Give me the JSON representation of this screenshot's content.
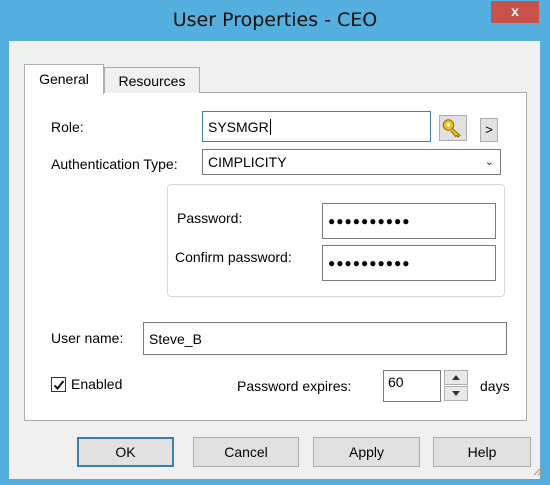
{
  "window": {
    "title": "User Properties - CEO",
    "close_glyph": "x"
  },
  "tabs": [
    {
      "label": "General",
      "active": true
    },
    {
      "label": "Resources",
      "active": false
    }
  ],
  "form": {
    "role_label": "Role:",
    "role_value": "SYSMGR",
    "role_lookup_icon": "key-icon",
    "role_more_label": ">",
    "auth_label": "Authentication Type:",
    "auth_value": "CIMPLICITY",
    "password_label": "Password:",
    "password_value": "●●●●●●●●●●",
    "confirm_label": "Confirm password:",
    "confirm_value": "●●●●●●●●●●",
    "username_label": "User name:",
    "username_value": "Steve_B",
    "enabled_label": "Enabled",
    "enabled_checked": true,
    "expires_label": "Password expires:",
    "expires_value": "60",
    "days_label": "days"
  },
  "buttons": {
    "ok": "OK",
    "cancel": "Cancel",
    "apply": "Apply",
    "help": "Help"
  },
  "colors": {
    "title_bar": "#54aede",
    "close_button": "#c7524a",
    "focus_border": "#3c7fb1",
    "dialog_bg": "#f0f0f0"
  }
}
